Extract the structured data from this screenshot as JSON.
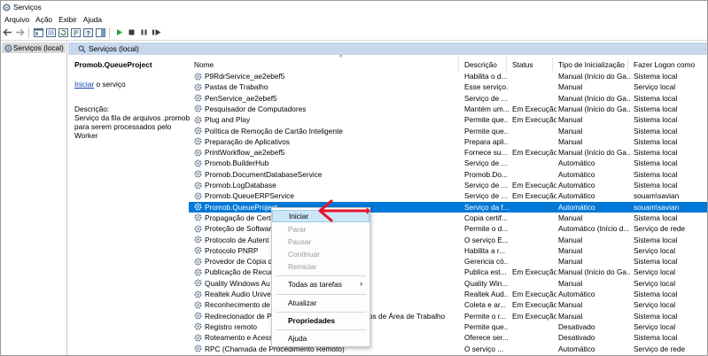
{
  "window": {
    "title": "Serviços"
  },
  "menu": [
    "Arquivo",
    "Ação",
    "Exibir",
    "Ajuda"
  ],
  "tree": {
    "root": "Serviços (local)"
  },
  "section": {
    "title": "Serviços (local)"
  },
  "details": {
    "title": "Promob.QueueProject",
    "action_link": "Iniciar",
    "action_suffix": " o serviço",
    "desc_label": "Descrição:",
    "desc_text": "Serviço da fila de arquivos .promob para serem processados pelo Worker"
  },
  "columns": {
    "name": "Nome",
    "description": "Descrição",
    "status": "Status",
    "startup": "Tipo de Inicialização",
    "logon": "Fazer Logon como"
  },
  "rows": [
    {
      "name": "P9RdrService_ae2ebef5",
      "desc": "Habilita o d...",
      "status": "",
      "type": "Manual (Início do Ga...",
      "logon": "Sistema local"
    },
    {
      "name": "Pastas de Trabalho",
      "desc": "Esse serviço...",
      "status": "",
      "type": "Manual",
      "logon": "Serviço local"
    },
    {
      "name": "PenService_ae2ebef5",
      "desc": "Serviço de ...",
      "status": "",
      "type": "Manual (Início do Ga...",
      "logon": "Sistema local"
    },
    {
      "name": "Pesquisador de Computadores",
      "desc": "Mantém um...",
      "status": "Em Execução",
      "type": "Manual (Início do Ga...",
      "logon": "Sistema local"
    },
    {
      "name": "Plug and Play",
      "desc": "Permite que...",
      "status": "Em Execução",
      "type": "Manual",
      "logon": "Sistema local"
    },
    {
      "name": "Política de Remoção de Cartão Inteligente",
      "desc": "Permite que...",
      "status": "",
      "type": "Manual",
      "logon": "Sistema local"
    },
    {
      "name": "Preparação de Aplicativos",
      "desc": "Prepara apli...",
      "status": "",
      "type": "Manual",
      "logon": "Sistema local"
    },
    {
      "name": "PrintWorkflow_ae2ebef5",
      "desc": "Fornece su...",
      "status": "Em Execução",
      "type": "Manual (Início do Ga...",
      "logon": "Sistema local"
    },
    {
      "name": "Promob.BuilderHub",
      "desc": "Serviço de ...",
      "status": "",
      "type": "Automático",
      "logon": "Sistema local"
    },
    {
      "name": "Promob.DocumentDatabaseService",
      "desc": "Promob.Do...",
      "status": "",
      "type": "Automático",
      "logon": "Sistema local"
    },
    {
      "name": "Promob.LogDatabase",
      "desc": "Serviço de ...",
      "status": "Em Execução",
      "type": "Automático",
      "logon": "Sistema local"
    },
    {
      "name": "Promob.QueueERPService",
      "desc": "Serviço de ...",
      "status": "Em Execução",
      "type": "Automático",
      "logon": "souam\\savian"
    },
    {
      "name": "Promob.QueueProject",
      "desc": "Serviço da f...",
      "status": "",
      "type": "Automático",
      "logon": "souam\\savian",
      "selected": true
    },
    {
      "name": "Propagação de Certi",
      "desc": "Copia certif...",
      "status": "",
      "type": "Manual",
      "logon": "Sistema local"
    },
    {
      "name": "Proteção de Softwar",
      "desc": "Permite o d...",
      "status": "",
      "type": "Automático (Início d...",
      "logon": "Serviço de rede"
    },
    {
      "name": "Protocolo de Autent",
      "desc": "O serviço E...",
      "status": "",
      "type": "Manual",
      "logon": "Sistema local"
    },
    {
      "name": "Protocolo PNRP",
      "desc": "Habilita a r...",
      "status": "",
      "type": "Manual",
      "logon": "Serviço local"
    },
    {
      "name": "Provedor de Cópia d",
      "extra": "ft",
      "desc": "Gerencia có...",
      "status": "",
      "type": "Manual",
      "logon": "Sistema local"
    },
    {
      "name": "Publicação de Recur",
      "desc": "Publica est...",
      "status": "Em Execução",
      "type": "Manual (Início do Ga...",
      "logon": "Serviço local"
    },
    {
      "name": "Quality Windows Au",
      "desc": "Quality Win...",
      "status": "",
      "type": "Manual",
      "logon": "Serviço local"
    },
    {
      "name": "Realtek Audio Unive",
      "desc": "Realtek Aud...",
      "status": "Em Execução",
      "type": "Automático",
      "logon": "Sistema local"
    },
    {
      "name": "Reconhecimento de",
      "desc": "Coleta e ar...",
      "status": "Em Execução",
      "type": "Manual",
      "logon": "Serviço local"
    },
    {
      "name": "Redirecionador de P",
      "extra": "rviços de Área de Trabalho",
      "desc": "Permite o r...",
      "status": "Em Execução",
      "type": "Manual",
      "logon": "Sistema local"
    },
    {
      "name": "Registro remoto",
      "desc": "Permite que...",
      "status": "",
      "type": "Desativado",
      "logon": "Serviço local"
    },
    {
      "name": "Roteamento e Acess",
      "desc": "Oferece ser...",
      "status": "",
      "type": "Desativado",
      "logon": "Sistema local"
    },
    {
      "name": "RPC (Chamada de Procedimento Remoto)",
      "desc": "O serviço ...",
      "status": "",
      "type": "Automático",
      "logon": "Serviço de rede"
    }
  ],
  "context_menu": {
    "start": "Iniciar",
    "stop": "Parar",
    "pause": "Pausar",
    "resume": "Continuar",
    "restart": "Reiniciar",
    "all_tasks": "Todas as tarefas",
    "refresh": "Atualizar",
    "properties": "Propriedades",
    "help": "Ajuda"
  },
  "colors": {
    "selection": "#0078d7",
    "header_band": "#c7d7ec",
    "annotation": "#e8122b",
    "run": "#1aa33a"
  }
}
